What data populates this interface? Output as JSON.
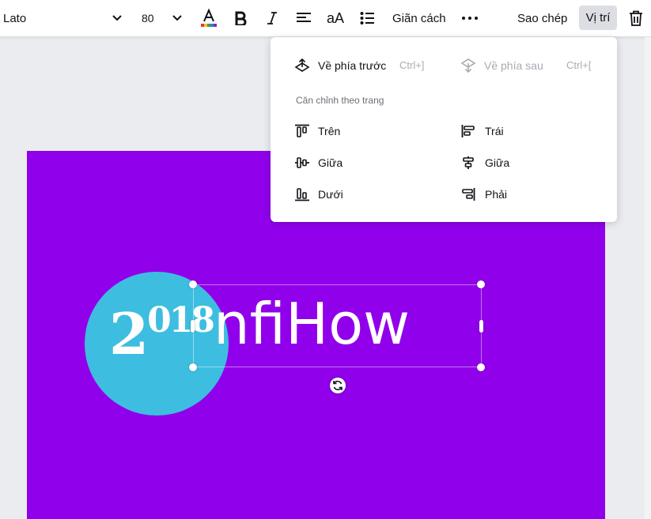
{
  "toolbar": {
    "font_family": "Lato",
    "font_size": "80",
    "case_label": "aA",
    "spacing_label": "Giãn cách",
    "copy_label": "Sao chép",
    "position_label": "Vị trí",
    "icons": [
      "chevron-down-icon",
      "text-color-icon",
      "bold-icon",
      "italic-icon",
      "align-left-icon",
      "list-icon",
      "more-icon",
      "trash-icon"
    ]
  },
  "canvas": {
    "background_color": "#9100eb",
    "circle_color": "#3dbee0",
    "year_big": "2",
    "year_small": "018",
    "brand_text": "nfiHow"
  },
  "dropdown": {
    "forward_label": "Về phía trước",
    "forward_shortcut": "Ctrl+]",
    "backward_label": "Về phía sau",
    "backward_shortcut": "Ctrl+[",
    "section_label": "Căn chỉnh theo trang",
    "align": {
      "top": "Trên",
      "middle_v": "Giữa",
      "bottom": "Dưới",
      "left": "Trái",
      "center_h": "Giữa",
      "right": "Phải"
    }
  }
}
